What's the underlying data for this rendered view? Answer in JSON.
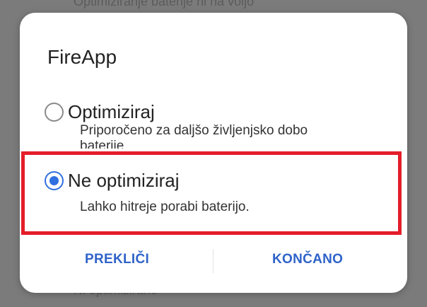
{
  "background": {
    "top_text": "Optimiziranje baterije ni na voljo",
    "bottom_text": "Ni optimizirano"
  },
  "dialog": {
    "title": "FireApp",
    "options": [
      {
        "label": "Optimiziraj",
        "description_line1": "Priporočeno za daljšo življenjsko dobo",
        "description_line2": "baterije",
        "selected": false
      },
      {
        "label": "Ne optimiziraj",
        "description_line1": "Lahko hitreje porabi baterijo.",
        "selected": true
      }
    ],
    "cancel_label": "PREKLIČI",
    "done_label": "KONČANO"
  },
  "colors": {
    "accent": "#2f6fe0",
    "highlight_border": "#e41d2a",
    "scrim": "#7b7b7b"
  },
  "icons": {
    "unselected": "radio-unchecked-icon",
    "selected": "radio-checked-icon"
  }
}
